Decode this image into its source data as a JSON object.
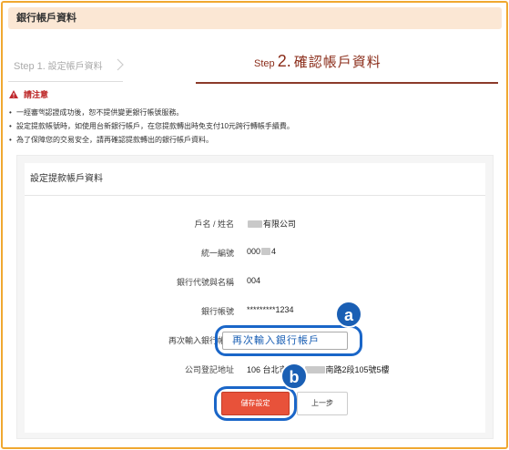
{
  "page": {
    "title": "銀行帳戶資料"
  },
  "steps": {
    "step1_prefix": "Step 1.",
    "step1_label": "設定帳戶資料",
    "step2_prefix": "Step",
    "step2_number": "2.",
    "step2_label": "確認帳戶資料"
  },
  "notice": {
    "title": "請注意",
    "items": [
      "一經審핵認證成功後，恕不提供變更銀行帳號服務。",
      "設定提款帳號時，如使用台新銀行帳戶，在您提款轉出時免支付10元跨行轉帳手續費。",
      "為了保障您的交易安全，請再確認提款轉出的銀行帳戶資料。"
    ]
  },
  "form": {
    "section_title": "設定提款帳戶資料",
    "name_label": "戶名 / 姓名",
    "name_value_suffix": "有限公司",
    "tax_id_label": "統一編號",
    "tax_id_prefix": "000",
    "tax_id_suffix": "4",
    "bank_label": "銀行代號與名稱",
    "bank_value": "004",
    "account_label": "銀行帳號",
    "account_value": "*********1234",
    "reenter_label": "再次輸入銀行帳號",
    "reenter_value": "再次輸入銀行帳戶",
    "address_label": "公司登記地址",
    "address_prefix": "106 台北市大安",
    "address_suffix": "南路2段105號5樓"
  },
  "buttons": {
    "save": "儲存設定",
    "back": "上一步"
  },
  "annotations": {
    "a": "a",
    "b": "b"
  },
  "colors": {
    "accent_orange": "#f0a830",
    "step_dark_red": "#8b2d1a",
    "save_red": "#e8523a",
    "annotation_blue": "#1a5fb4"
  }
}
